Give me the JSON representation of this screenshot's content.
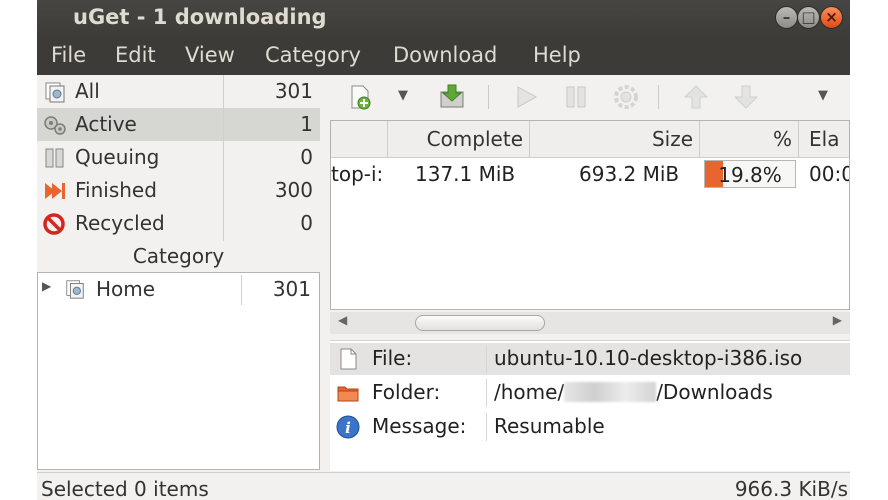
{
  "window": {
    "title": "uGet - 1 downloading"
  },
  "menu": [
    "File",
    "Edit",
    "View",
    "Category",
    "Download",
    "Help"
  ],
  "status_categories": [
    {
      "label": "All",
      "count": "301",
      "icon": "all-icon"
    },
    {
      "label": "Active",
      "count": "1",
      "icon": "active-icon",
      "selected": true
    },
    {
      "label": "Queuing",
      "count": "0",
      "icon": "queuing-icon"
    },
    {
      "label": "Finished",
      "count": "300",
      "icon": "finished-icon"
    },
    {
      "label": "Recycled",
      "count": "0",
      "icon": "recycled-icon"
    }
  ],
  "category_panel": {
    "header": "Category",
    "items": [
      {
        "label": "Home",
        "count": "301"
      }
    ]
  },
  "download_list": {
    "columns": [
      "Complete",
      "Size",
      "%",
      "Ela"
    ],
    "rows": [
      {
        "name": "top-i:",
        "complete": "137.1 MiB",
        "size": "693.2 MiB",
        "percent": 19.8,
        "percent_text": "19.8%",
        "elapsed": "00:0"
      }
    ]
  },
  "info": {
    "file_label": "File:",
    "file_value": "ubuntu-10.10-desktop-i386.iso",
    "folder_label": "Folder:",
    "folder_value_start": "/home/",
    "folder_value_end": "/Downloads",
    "message_label": "Message:",
    "message_value": "Resumable"
  },
  "statusbar": {
    "selected": "Selected 0 items",
    "speed": "966.3 KiB/s"
  },
  "colors": {
    "titlebar": "#3c3b37",
    "progress": "#e8652f",
    "close_button": "#df4a16"
  }
}
